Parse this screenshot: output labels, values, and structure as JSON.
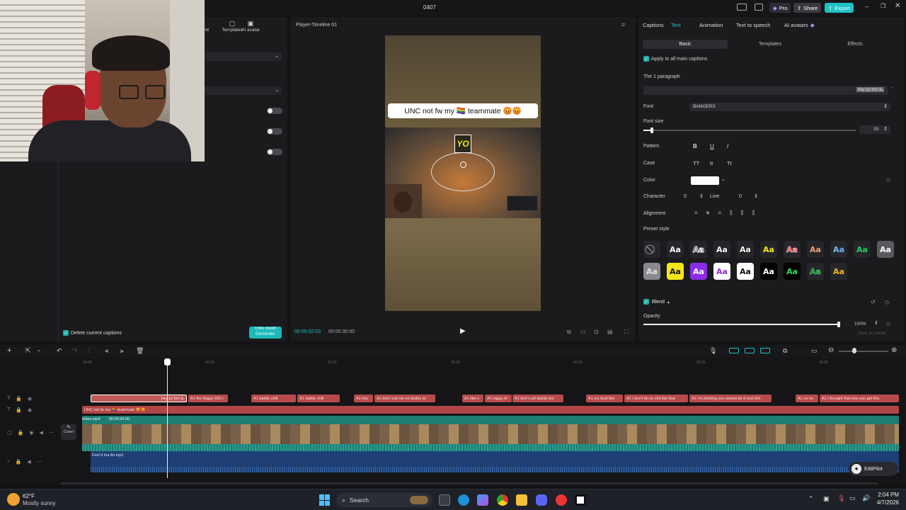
{
  "window": {
    "title": "0407",
    "pro_label": "Pro",
    "share_label": "Share",
    "export_label": "Export"
  },
  "left_panel": {
    "tabs": [
      {
        "label": "ent"
      },
      {
        "label": "Templates"
      },
      {
        "label": "AI avatar"
      }
    ],
    "delete_captions_label": "Delete current captions",
    "generate_badge": "It this month",
    "generate_label": "Generate"
  },
  "player": {
    "title": "Player-Timeline 01",
    "caption_text": "UNC not fw my 🏳️‍🌈 teammate 😡😡",
    "sticker_text": "YO",
    "current_time": "00:00:02:03",
    "total_time": "00:00:30:00"
  },
  "right_panel": {
    "tabs": [
      {
        "label": "Captions"
      },
      {
        "label": "Text"
      },
      {
        "label": "Animation"
      },
      {
        "label": "Text to speech"
      },
      {
        "label": "AI avatars"
      }
    ],
    "subtabs": [
      {
        "label": "Basic"
      },
      {
        "label": "Templates"
      },
      {
        "label": "Effects"
      }
    ],
    "apply_all_label": "Apply to all main captions",
    "paragraph_label": "The 1 paragraph",
    "paragraph_value": "hey yo bro یلا ",
    "font_label": "Font",
    "font_value": "BANGERS",
    "font_size_label": "Font size",
    "font_size_value": "15",
    "font_size_fraction": 0.04,
    "pattern_label": "Pattern",
    "pattern_buttons": [
      "B",
      "U",
      "I"
    ],
    "case_label": "Case",
    "case_buttons": [
      "TT",
      "tt",
      "Tt"
    ],
    "color_label": "Color",
    "color_value": "#ffffff",
    "character_label": "Character",
    "character_value": "0",
    "line_label": "Line",
    "line_value": "0",
    "alignment_label": "Alignment",
    "preset_label": "Preset style",
    "preset_glyph": "Aa",
    "blend_label": "Blend",
    "opacity_label": "Opacity",
    "opacity_value": "100%",
    "save_preset_label": "Save as preset"
  },
  "toolbar": {
    "editpilot_label": "EditPilot"
  },
  "timeline": {
    "ruler": [
      "00:00",
      "00:05",
      "00:10",
      "00:15",
      "00:20",
      "00:25",
      "00:30"
    ],
    "captions": [
      "hey yo bro یلا",
      "A1 the Nigga 100 c",
      "A1 daddy chill",
      "A1 daddy chill",
      "A1 hey",
      "A1 don't call me no daddy br",
      "A1 like n",
      "A1 nigga sh",
      "A1 don't call daddy bro",
      "A1 my fault like",
      "A1 I don't do no shit like that",
      "A1 I'm thinking you wanna be d and shit",
      "A1 no no",
      "A1 I thought that was you get this"
    ],
    "text_clip": "UNC not fw my 🏳️‍🌈 teammate 😡😡",
    "video_clip_name": "index.mp4",
    "video_clip_duration": "00:00:30:00",
    "cover_label": "Cover",
    "audio_clip": "Feel It Ina Air.mp3"
  },
  "taskbar": {
    "weather_temp": "62°F",
    "weather_desc": "Mostly sunny",
    "search_label": "Search",
    "time": "2:04 PM",
    "date": "4/7/2026"
  }
}
